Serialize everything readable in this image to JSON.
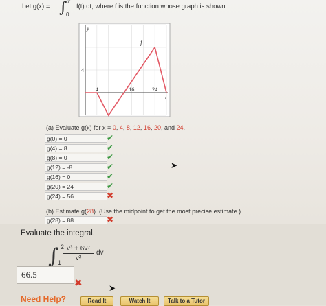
{
  "intro": {
    "prefix": "Let  g(x) =",
    "upper_limit": "x",
    "lower_limit": "0",
    "integrand_text": "f(t)  dt,   where f is the function whose graph is shown."
  },
  "graph": {
    "y_axis_label": "y",
    "x_axis_label": "t",
    "function_label": "f",
    "x_ticks": [
      "4",
      "16",
      "24"
    ],
    "y_ticks": [
      "4"
    ],
    "chart_data": {
      "type": "line",
      "series": [
        {
          "name": "f",
          "x": [
            0,
            4,
            8,
            24,
            28
          ],
          "y": [
            0,
            0,
            -4,
            8,
            0
          ]
        }
      ],
      "xlabel": "t",
      "ylabel": "y",
      "xlim": [
        0,
        28
      ],
      "ylim": [
        -4,
        12
      ],
      "grid": true
    }
  },
  "part_a": {
    "prefix": "(a) Evaluate g(x) for x =",
    "values": [
      "0",
      "4",
      "8",
      "12",
      "16",
      "20",
      "24"
    ],
    "rows": [
      {
        "label": "g(0)",
        "value": "0",
        "status": "correct"
      },
      {
        "label": "g(4)",
        "value": "8",
        "status": "correct"
      },
      {
        "label": "g(8)",
        "value": "0",
        "status": "correct"
      },
      {
        "label": "g(12)",
        "value": "-8",
        "status": "correct"
      },
      {
        "label": "g(16)",
        "value": "0",
        "status": "correct"
      },
      {
        "label": "g(20)",
        "value": "24",
        "status": "correct"
      },
      {
        "label": "g(24)",
        "value": "56",
        "status": "incorrect"
      }
    ]
  },
  "part_b": {
    "prefix": "(b) Estimate g(",
    "arg": "28",
    "suffix": ").  (Use the midpoint to get the most precise estimate.)",
    "row": {
      "label": "g(28)",
      "value": "88",
      "status": "incorrect"
    }
  },
  "evaluate": {
    "title": "Evaluate the integral.",
    "upper": "2",
    "lower": "1",
    "numerator": "v³ + 6v⁷",
    "denominator": "v²",
    "differential": "dv",
    "answer": "66.5",
    "status": "incorrect"
  },
  "help": {
    "label": "Need Help?",
    "buttons": [
      "Read It",
      "Watch It",
      "Talk to a Tutor"
    ]
  },
  "colors": {
    "correct": "#3d9a43",
    "incorrect": "#d23b2c",
    "highlight": "#d23b2c",
    "help_label": "#e56a2b",
    "button": "#e8c26b"
  }
}
